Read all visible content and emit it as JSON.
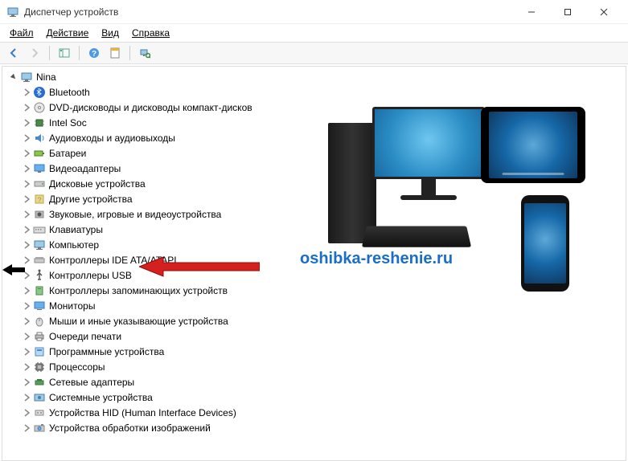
{
  "window": {
    "title": "Диспетчер устройств"
  },
  "menu": {
    "file": "Файл",
    "action": "Действие",
    "view": "Вид",
    "help": "Справка"
  },
  "tree": {
    "root": "Nina",
    "items": [
      {
        "label": "Bluetooth",
        "icon": "bluetooth"
      },
      {
        "label": "DVD-дисководы и дисководы компакт-дисков",
        "icon": "disc"
      },
      {
        "label": "Intel Soc",
        "icon": "chip"
      },
      {
        "label": "Аудиовходы и аудиовыходы",
        "icon": "audio"
      },
      {
        "label": "Батареи",
        "icon": "battery"
      },
      {
        "label": "Видеоадаптеры",
        "icon": "display"
      },
      {
        "label": "Дисковые устройства",
        "icon": "drive"
      },
      {
        "label": "Другие устройства",
        "icon": "other"
      },
      {
        "label": "Звуковые, игровые и видеоустройства",
        "icon": "sound"
      },
      {
        "label": "Клавиатуры",
        "icon": "keyboard"
      },
      {
        "label": "Компьютер",
        "icon": "computer"
      },
      {
        "label": "Контроллеры IDE ATA/ATAPI",
        "icon": "ide"
      },
      {
        "label": "Контроллеры USB",
        "icon": "usb"
      },
      {
        "label": "Контроллеры запоминающих устройств",
        "icon": "storage"
      },
      {
        "label": "Мониторы",
        "icon": "monitor"
      },
      {
        "label": "Мыши и иные указывающие устройства",
        "icon": "mouse"
      },
      {
        "label": "Очереди печати",
        "icon": "printer"
      },
      {
        "label": "Программные устройства",
        "icon": "software"
      },
      {
        "label": "Процессоры",
        "icon": "cpu"
      },
      {
        "label": "Сетевые адаптеры",
        "icon": "network"
      },
      {
        "label": "Системные устройства",
        "icon": "system"
      },
      {
        "label": "Устройства HID (Human Interface Devices)",
        "icon": "hid"
      },
      {
        "label": "Устройства обработки изображений",
        "icon": "imaging"
      }
    ]
  },
  "watermark": "oshibka-reshenie.ru",
  "highlighted_index": 12
}
